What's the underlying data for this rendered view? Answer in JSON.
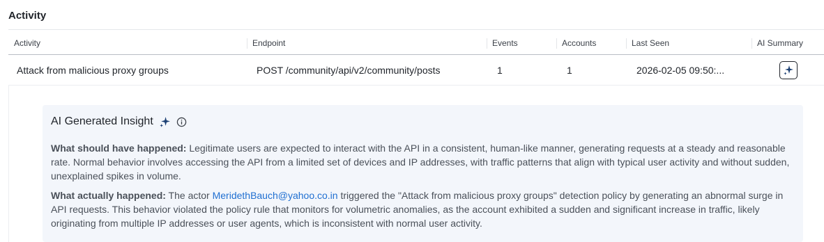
{
  "section": {
    "title": "Activity"
  },
  "table": {
    "headers": [
      "Activity",
      "Endpoint",
      "Events",
      "Accounts",
      "Last Seen",
      "AI Summary"
    ],
    "rows": [
      {
        "activity": "Attack from malicious proxy groups",
        "endpoint": "POST /community/api/v2/community/posts",
        "events": "1",
        "accounts": "1",
        "last_seen": "2026-02-05 09:50:..."
      }
    ]
  },
  "insight": {
    "title": "AI Generated Insight",
    "should_label": "What should have happened:",
    "should_text": " Legitimate users are expected to interact with the API in a consistent, human-like manner, generating requests at a steady and reasonable rate. Normal behavior involves accessing the API from a limited set of devices and IP addresses, with traffic patterns that align with typical user activity and without sudden, unexplained spikes in volume.",
    "actual_label": "What actually happened:",
    "actual_pre": " The actor ",
    "actor_email": "MeridethBauch@yahoo.co.in",
    "actual_post": " triggered the \"Attack from malicious proxy groups\" detection policy by generating an abnormal surge in API requests. This behavior violated the policy rule that monitors for volumetric anomalies, as the account exhibited a sudden and significant increase in traffic, likely originating from multiple IP addresses or user agents, which is inconsistent with normal user activity."
  },
  "colors": {
    "link": "#1f6fd1",
    "insight_bg": "#f3f6fb",
    "sparkle": "#1b3f73"
  },
  "icons": {
    "ai_summary": "sparkle-icon",
    "insight_sparkle": "sparkle-icon",
    "info": "info-icon"
  }
}
